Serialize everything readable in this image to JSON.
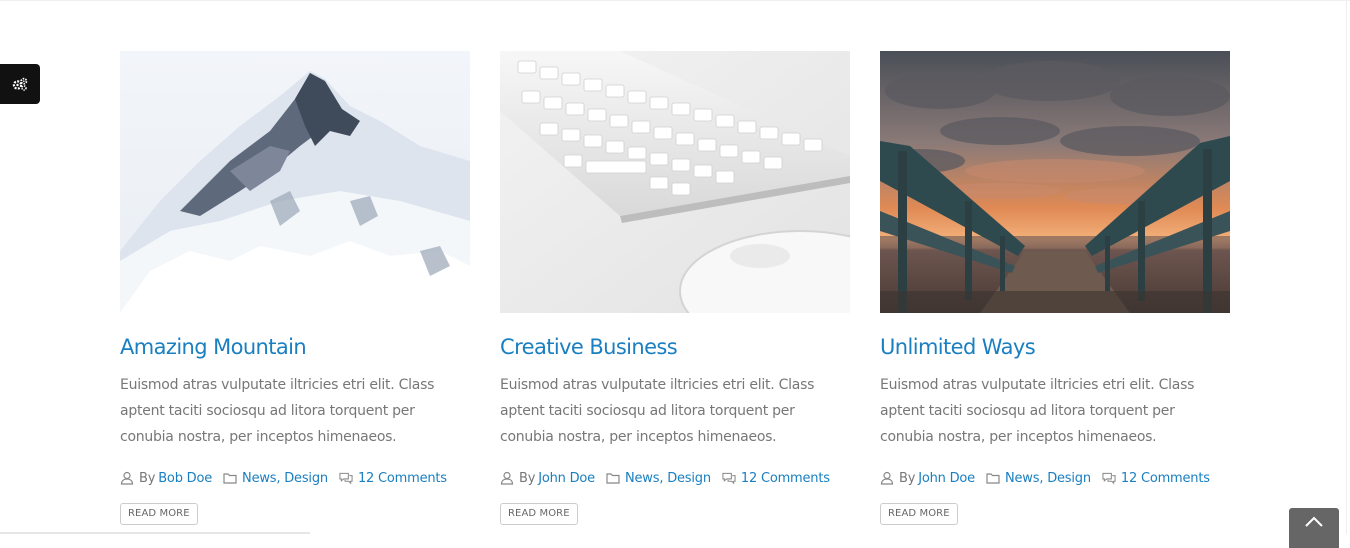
{
  "settings": {
    "icon": "gears-icon"
  },
  "posts": [
    {
      "image": "snowy-mountain-photo",
      "title": "Amazing Mountain",
      "excerpt": "Euismod atras vulputate iltricies etri elit. Class aptent taciti sociosqu ad litora torquent per conubia nostra, per inceptos himenaeos.",
      "by": "By",
      "author": "Bob Doe",
      "categories": [
        "News",
        "Design"
      ],
      "comments": "12 Comments",
      "read_more": "READ MORE"
    },
    {
      "image": "keyboard-mouse-photo",
      "title": "Creative Business",
      "excerpt": "Euismod atras vulputate iltricies etri elit. Class aptent taciti sociosqu ad litora torquent per conubia nostra, per inceptos himenaeos.",
      "by": "By",
      "author": "John Doe",
      "categories": [
        "News",
        "Design"
      ],
      "comments": "12 Comments",
      "read_more": "READ MORE"
    },
    {
      "image": "beach-sunset-walkway-photo",
      "title": "Unlimited Ways",
      "excerpt": "Euismod atras vulputate iltricies etri elit. Class aptent taciti sociosqu ad litora torquent per conubia nostra, per inceptos himenaeos.",
      "by": "By",
      "author": "John Doe",
      "categories": [
        "News",
        "Design"
      ],
      "comments": "12 Comments",
      "read_more": "READ MORE"
    }
  ],
  "scroll_top": {
    "icon": "chevron-up-icon"
  },
  "colors": {
    "link": "#1a7fc1",
    "text": "#777777",
    "dark": "#111111"
  }
}
